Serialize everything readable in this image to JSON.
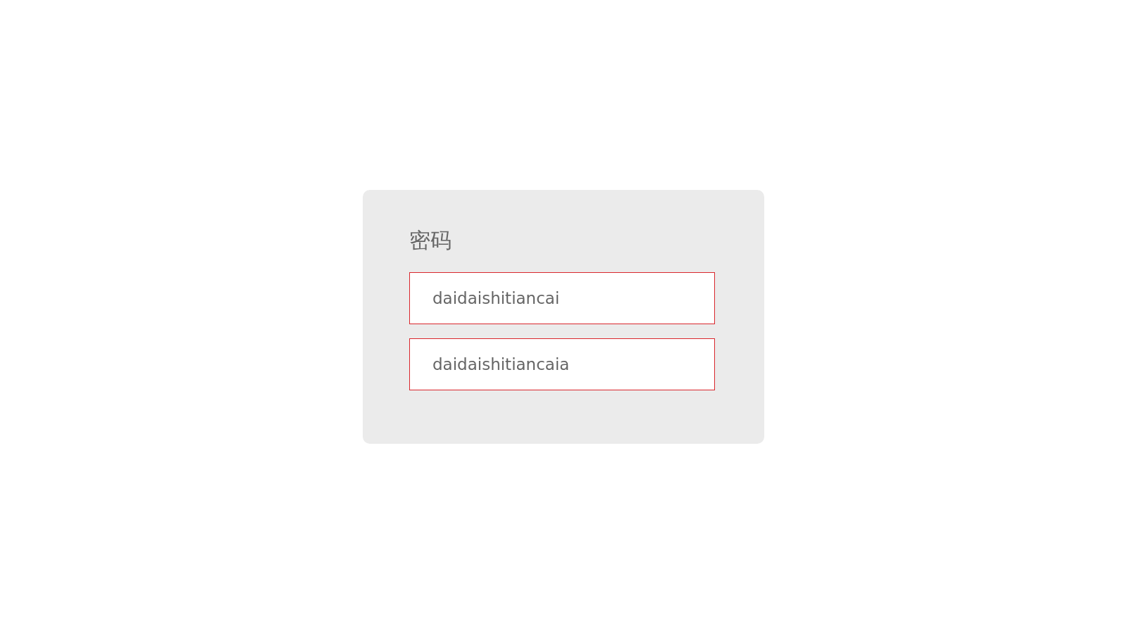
{
  "card": {
    "title": "密码",
    "fields": [
      {
        "value": "daidaishitiancai"
      },
      {
        "value": "daidaishitiancaia"
      }
    ]
  }
}
